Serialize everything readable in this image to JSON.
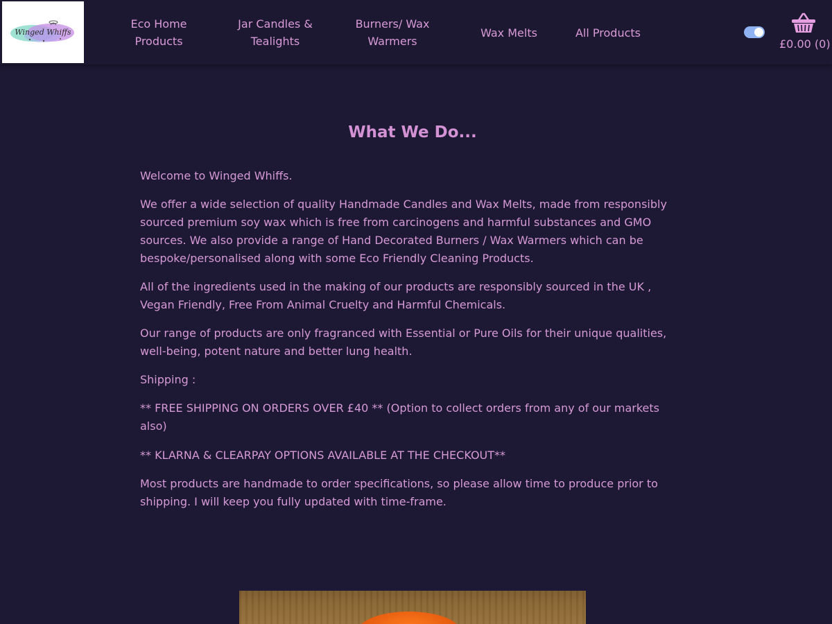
{
  "site": {
    "logo_text": "Winged Whiffs"
  },
  "nav": {
    "items": [
      {
        "line1": "Eco Home",
        "line2": "Products"
      },
      {
        "line1": "Jar Candles &",
        "line2": "Tealights"
      },
      {
        "line1": "Burners/ Wax",
        "line2": "Warmers"
      },
      {
        "line1": "Wax Melts",
        "line2": ""
      },
      {
        "line1": "All Products",
        "line2": ""
      }
    ]
  },
  "cart": {
    "total": "£0.00 (0)",
    "icon": "basket-icon"
  },
  "theme_toggle": {
    "state": "on",
    "icon": "toggle-switch"
  },
  "content": {
    "title": "What We Do...",
    "paragraphs": [
      "Welcome to Winged Whiffs.",
      "We offer a wide selection of quality Handmade Candles and Wax Melts, made from responsibly sourced premium soy wax which is free from carcinogens and harmful substances and GMO sources. We also provide a range of Hand Decorated Burners / Wax Warmers which can be bespoke/personalised along with some Eco Friendly Cleaning Products.",
      "All of the ingredients used in the making of our products are responsibly sourced in the UK , Vegan Friendly, Free From Animal Cruelty and Harmful Chemicals.",
      "Our range of products are only fragranced with Essential or Pure Oils for their unique qualities, well-being, potent nature and better lung health.",
      "Shipping :",
      "** FREE SHIPPING ON ORDERS OVER £40 ** (Option to collect orders from any of our markets also)",
      "** KLARNA & CLEARPAY OPTIONS AVAILABLE AT THE CHECKOUT**",
      "Most products are handmade to order specifications, so please allow time to produce prior to shipping. I will keep you fully updated with time-frame."
    ]
  },
  "colors": {
    "background": "#1d1833",
    "header": "#1c1831",
    "text": "#d69ad6",
    "title": "#d392d4",
    "toggle": "#8fb2f2",
    "basket": "#e59ee0"
  }
}
